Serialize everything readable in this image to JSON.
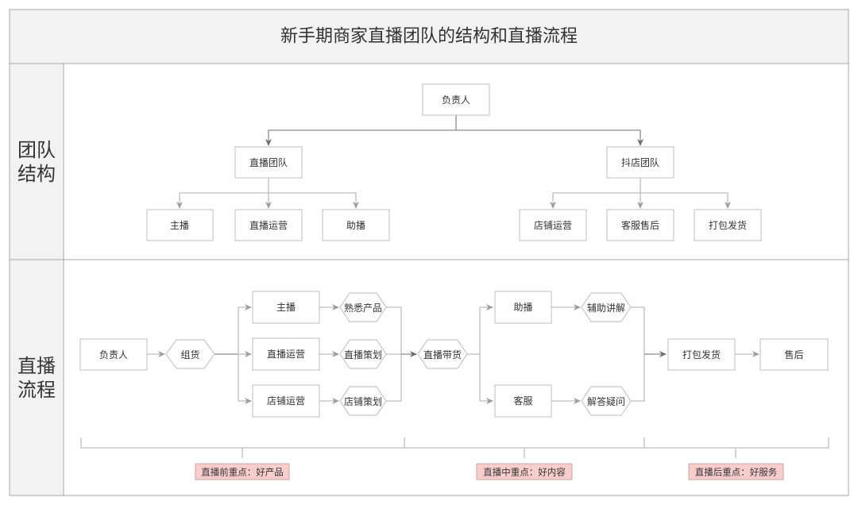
{
  "title": "新手期商家直播团队的结构和直播流程",
  "sections": {
    "team_structure": {
      "label_line1": "团队",
      "label_line2": "结构"
    },
    "live_flow": {
      "label_line1": "直播",
      "label_line2": "流程"
    }
  },
  "org_chart": {
    "root": "负责人",
    "branches": [
      {
        "label": "直播团队",
        "children": [
          "主播",
          "直播运营",
          "助播"
        ]
      },
      {
        "label": "抖店团队",
        "children": [
          "店铺运营",
          "客服售后",
          "打包发货"
        ]
      }
    ]
  },
  "flow": {
    "start": "负责人",
    "step1": "组货",
    "pre_live": [
      {
        "role": "主播",
        "task": "熟悉产品"
      },
      {
        "role": "直播运营",
        "task": "直播策划"
      },
      {
        "role": "店铺运营",
        "task": "店铺策划"
      }
    ],
    "step2": "直播带货",
    "during_live": [
      {
        "role": "助播",
        "task": "辅助讲解"
      },
      {
        "role": "客服",
        "task": "解答疑问"
      }
    ],
    "post_live": [
      "打包发货",
      "售后"
    ]
  },
  "focus_badges": [
    "直播前重点：好产品",
    "直播中重点：好内容",
    "直播后重点：好服务"
  ],
  "colors": {
    "band_bg": "#f2f2f2",
    "frame": "#a6a6a6",
    "node_border": "#c8c8c8",
    "badge_fill": "#f8cecc",
    "text": "#333333"
  }
}
